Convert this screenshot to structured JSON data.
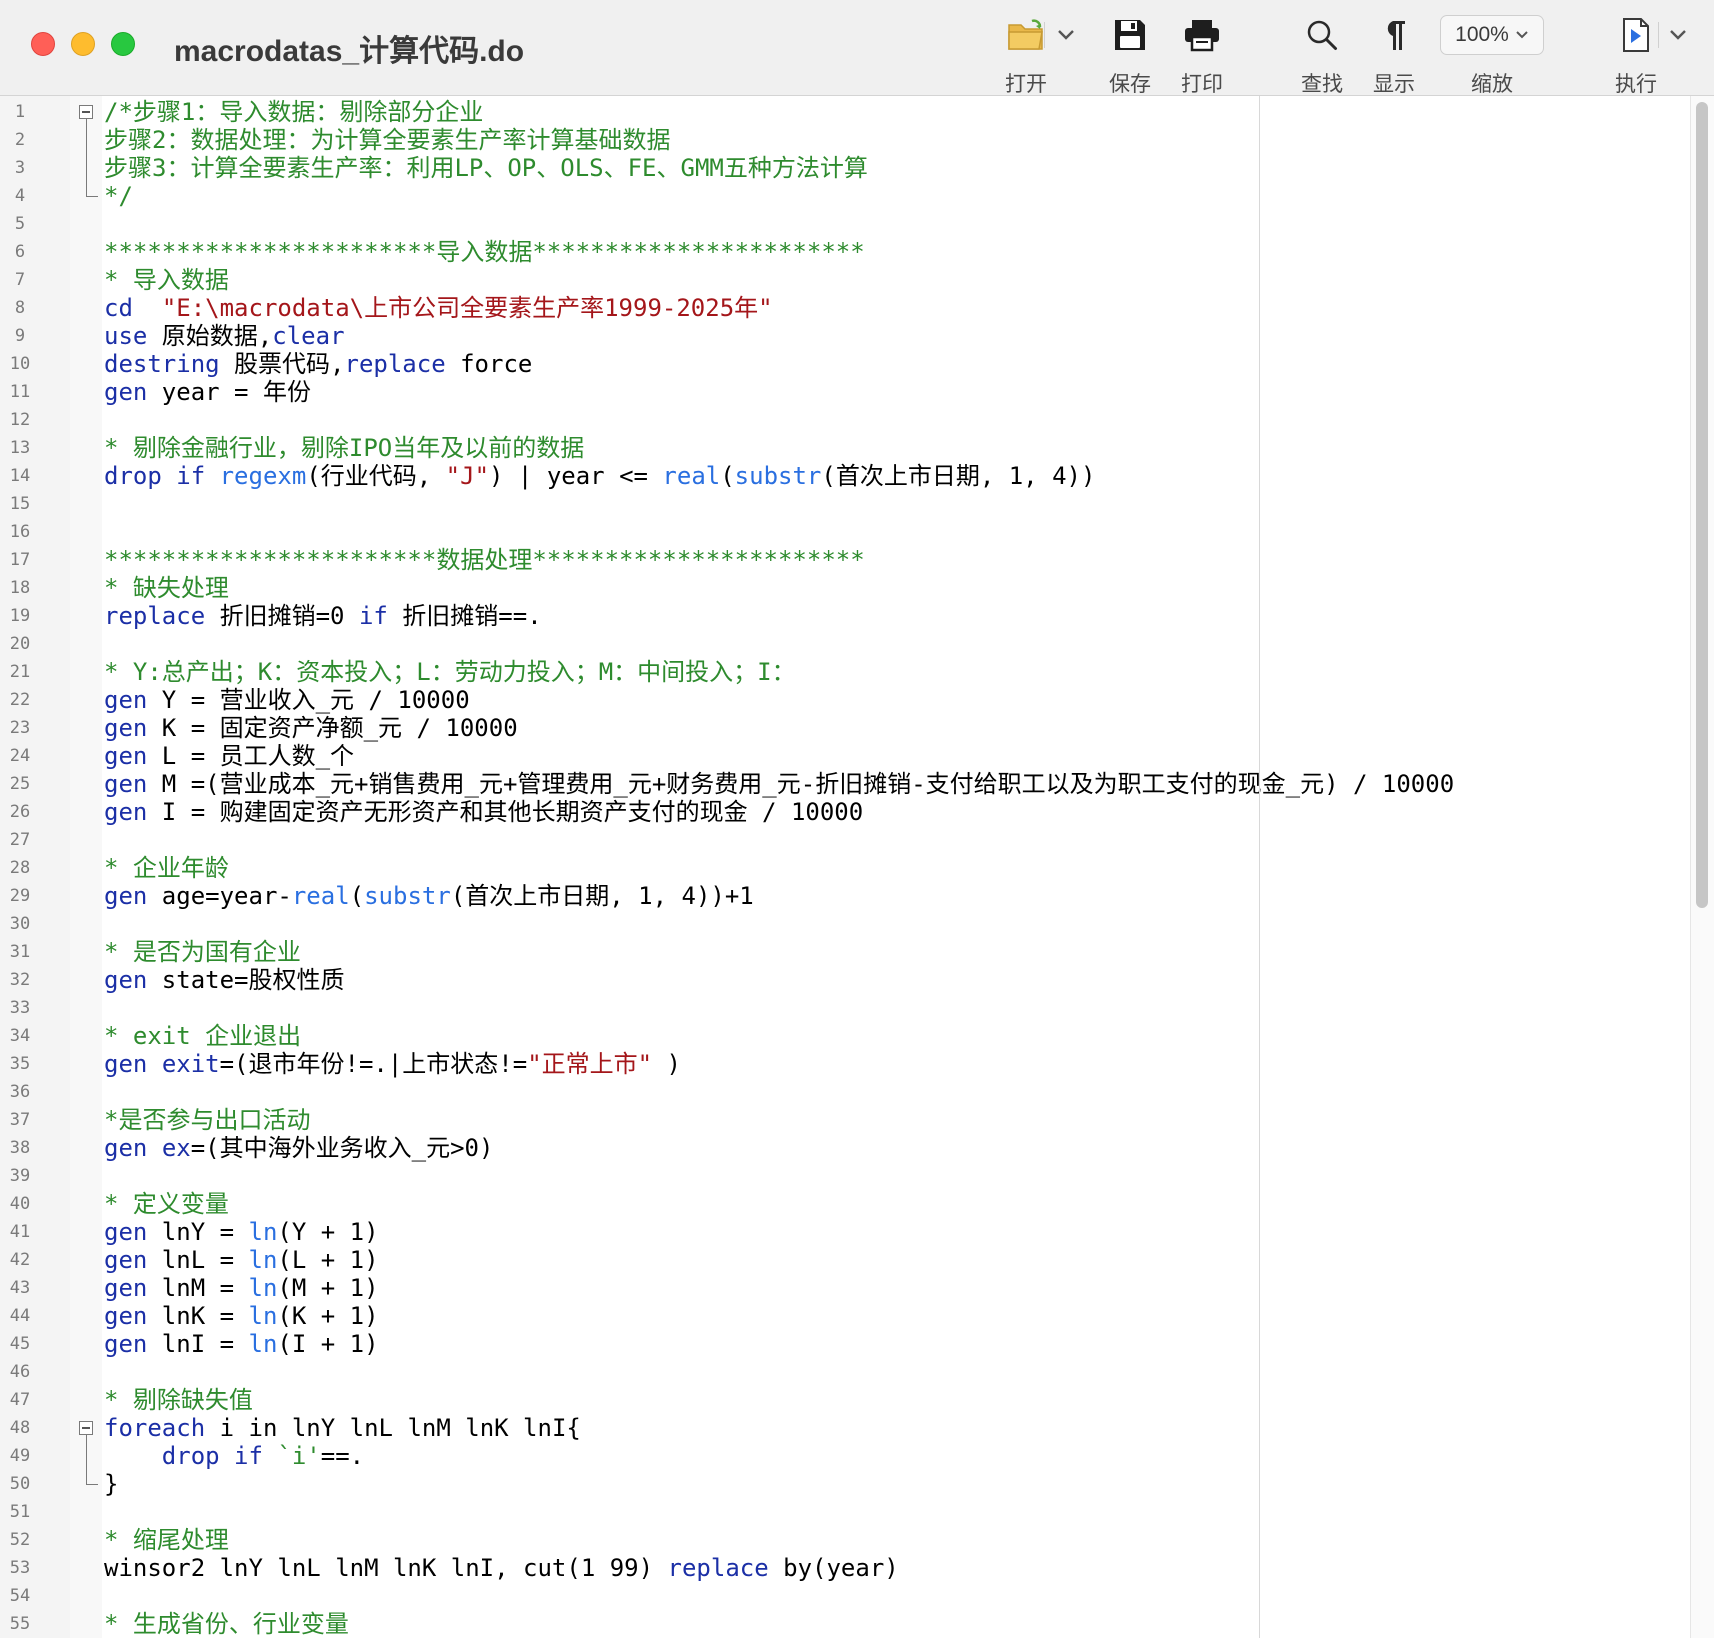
{
  "window": {
    "title": "macrodatas_计算代码.do"
  },
  "toolbar": {
    "open_label": "打开",
    "save_label": "保存",
    "print_label": "打印",
    "find_label": "查找",
    "show_label": "显示",
    "zoom_value": "100%",
    "zoom_label": "缩放",
    "run_label": "执行"
  },
  "icons": {
    "open": "folder-open-icon",
    "save": "floppy-disk-icon",
    "print": "printer-icon",
    "find": "magnifier-icon",
    "show": "pilcrow-icon",
    "run": "do-file-run-icon"
  },
  "colors": {
    "comment": "#2e8b2e",
    "keyword": "#1b2fa6",
    "function": "#2a6fe0",
    "string": "#a4161a",
    "close": "#ff5f57",
    "minimize": "#febc2e",
    "maximize": "#28c840"
  },
  "editor": {
    "lines": [
      [
        [
          "cmt",
          "/*步骤1：导入数据：剔除部分企业"
        ]
      ],
      [
        [
          "cmt",
          "步骤2：数据处理：为计算全要素生产率计算基础数据"
        ]
      ],
      [
        [
          "cmt",
          "步骤3：计算全要素生产率：利用LP、OP、OLS、FE、GMM五种方法计算"
        ]
      ],
      [
        [
          "cmt",
          "*/"
        ]
      ],
      [],
      [
        [
          "cmt",
          "***********************导入数据***********************"
        ]
      ],
      [
        [
          "cmt",
          "* 导入数据"
        ]
      ],
      [
        [
          "kw",
          "cd"
        ],
        [
          "",
          "  "
        ],
        [
          "str",
          "\"E:\\macrodata\\上市公司全要素生产率1999-2025年\""
        ]
      ],
      [
        [
          "kw",
          "use"
        ],
        [
          "",
          " 原始数据,"
        ],
        [
          "kw",
          "clear"
        ]
      ],
      [
        [
          "kw",
          "destring"
        ],
        [
          "",
          " 股票代码,"
        ],
        [
          "kw",
          "replace"
        ],
        [
          "",
          " force"
        ]
      ],
      [
        [
          "kw",
          "gen"
        ],
        [
          "",
          " year = 年份"
        ]
      ],
      [],
      [
        [
          "cmt",
          "* 剔除金融行业，剔除IPO当年及以前的数据"
        ]
      ],
      [
        [
          "kw",
          "drop"
        ],
        [
          "",
          " "
        ],
        [
          "kw",
          "if"
        ],
        [
          "",
          " "
        ],
        [
          "fn",
          "regexm"
        ],
        [
          "",
          "(行业代码, "
        ],
        [
          "str",
          "\"J\""
        ],
        [
          "",
          ") | year <= "
        ],
        [
          "fn",
          "real"
        ],
        [
          "",
          "("
        ],
        [
          "fn",
          "substr"
        ],
        [
          "",
          "(首次上市日期, 1, 4))"
        ]
      ],
      [],
      [],
      [
        [
          "cmt",
          "***********************数据处理***********************"
        ]
      ],
      [
        [
          "cmt",
          "* 缺失处理"
        ]
      ],
      [
        [
          "kw",
          "replace"
        ],
        [
          "",
          " 折旧摊销=0 "
        ],
        [
          "kw",
          "if"
        ],
        [
          "",
          " 折旧摊销==."
        ]
      ],
      [],
      [
        [
          "cmt",
          "* Y:总产出；K：资本投入；L：劳动力投入；M：中间投入；I："
        ]
      ],
      [
        [
          "kw",
          "gen"
        ],
        [
          "",
          " Y = 营业收入_元 / 10000"
        ]
      ],
      [
        [
          "kw",
          "gen"
        ],
        [
          "",
          " K = 固定资产净额_元 / 10000"
        ]
      ],
      [
        [
          "kw",
          "gen"
        ],
        [
          "",
          " L = 员工人数_个"
        ]
      ],
      [
        [
          "kw",
          "gen"
        ],
        [
          "",
          " M =(营业成本_元+销售费用_元+管理费用_元+财务费用_元-折旧摊销-支付给职工以及为职工支付的现金_元) / 10000"
        ]
      ],
      [
        [
          "kw",
          "gen"
        ],
        [
          "",
          " I = 购建固定资产无形资产和其他长期资产支付的现金 / 10000"
        ]
      ],
      [],
      [
        [
          "cmt",
          "* 企业年龄"
        ]
      ],
      [
        [
          "kw",
          "gen"
        ],
        [
          "",
          " age=year-"
        ],
        [
          "fn",
          "real"
        ],
        [
          "",
          "("
        ],
        [
          "fn",
          "substr"
        ],
        [
          "",
          "(首次上市日期, 1, 4))+1"
        ]
      ],
      [],
      [
        [
          "cmt",
          "* 是否为国有企业"
        ]
      ],
      [
        [
          "kw",
          "gen"
        ],
        [
          "",
          " state=股权性质"
        ]
      ],
      [],
      [
        [
          "cmt",
          "* exit 企业退出"
        ]
      ],
      [
        [
          "kw",
          "gen"
        ],
        [
          "",
          " "
        ],
        [
          "kw",
          "exit"
        ],
        [
          "",
          "=(退市年份!=.|上市状态!="
        ],
        [
          "str",
          "\"正常上市\""
        ],
        [
          "",
          " )"
        ]
      ],
      [],
      [
        [
          "cmt",
          "*是否参与出口活动"
        ]
      ],
      [
        [
          "kw",
          "gen"
        ],
        [
          "",
          " "
        ],
        [
          "kw",
          "ex"
        ],
        [
          "",
          "=(其中海外业务收入_元>0)"
        ]
      ],
      [],
      [
        [
          "cmt",
          "* 定义变量"
        ]
      ],
      [
        [
          "kw",
          "gen"
        ],
        [
          "",
          " lnY = "
        ],
        [
          "fn",
          "ln"
        ],
        [
          "",
          "(Y + 1)"
        ]
      ],
      [
        [
          "kw",
          "gen"
        ],
        [
          "",
          " lnL = "
        ],
        [
          "fn",
          "ln"
        ],
        [
          "",
          "(L + 1)"
        ]
      ],
      [
        [
          "kw",
          "gen"
        ],
        [
          "",
          " lnM = "
        ],
        [
          "fn",
          "ln"
        ],
        [
          "",
          "(M + 1)"
        ]
      ],
      [
        [
          "kw",
          "gen"
        ],
        [
          "",
          " lnK = "
        ],
        [
          "fn",
          "ln"
        ],
        [
          "",
          "(K + 1)"
        ]
      ],
      [
        [
          "kw",
          "gen"
        ],
        [
          "",
          " lnI = "
        ],
        [
          "fn",
          "ln"
        ],
        [
          "",
          "(I + 1)"
        ]
      ],
      [],
      [
        [
          "cmt",
          "* 剔除缺失值"
        ]
      ],
      [
        [
          "kw",
          "foreach"
        ],
        [
          "",
          " i in lnY lnL lnM lnK lnI{"
        ]
      ],
      [
        [
          "",
          "    "
        ],
        [
          "kw",
          "drop"
        ],
        [
          "",
          " "
        ],
        [
          "kw",
          "if"
        ],
        [
          "",
          " "
        ],
        [
          "mac",
          "`i'"
        ],
        [
          "",
          "==."
        ]
      ],
      [
        [
          "",
          "}"
        ]
      ],
      [],
      [
        [
          "cmt",
          "* 缩尾处理"
        ]
      ],
      [
        [
          "",
          "winsor2 lnY lnL lnM lnK lnI, cut(1 99) "
        ],
        [
          "kw",
          "replace"
        ],
        [
          "",
          " by(year)"
        ]
      ],
      [],
      [
        [
          "cmt",
          "* 生成省份、行业变量"
        ]
      ]
    ]
  }
}
